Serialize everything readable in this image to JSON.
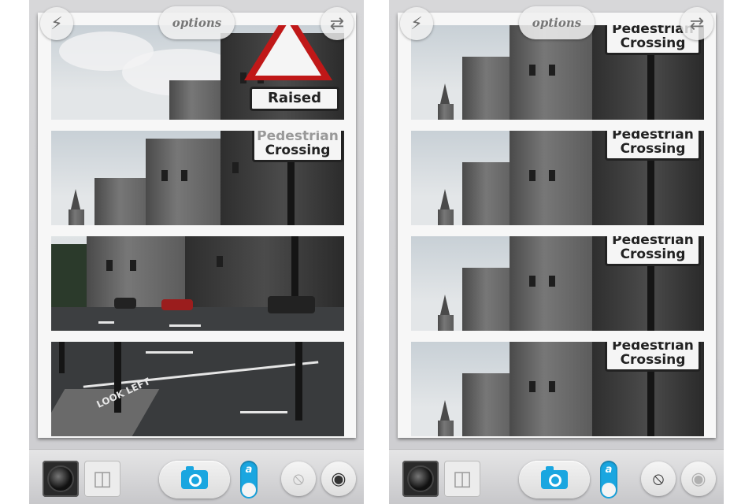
{
  "screens": [
    {
      "options_label": "options",
      "top_left_icon": "flash-icon",
      "top_right_icon": "switch-camera-icon",
      "sign_top": "Raised",
      "sign_mid": "Pedestrian",
      "sign_bottom": "Crossing",
      "road_text": "LOOK LEFT",
      "toggle_letter": "a"
    },
    {
      "options_label": "options",
      "top_left_icon": "flash-icon",
      "top_right_icon": "switch-camera-icon",
      "sign_mid": "Pedestrian",
      "sign_bottom": "Crossing",
      "toggle_letter": "a"
    }
  ],
  "toolbar_icons": [
    "lens-icon",
    "layout-icon",
    "camera-icon",
    "mode-toggle",
    "hide-preview-icon",
    "eye-icon"
  ],
  "colors": {
    "accent": "#1aa6e0",
    "card": "#f7f7f7",
    "toolbar": "#d6d6d8"
  }
}
